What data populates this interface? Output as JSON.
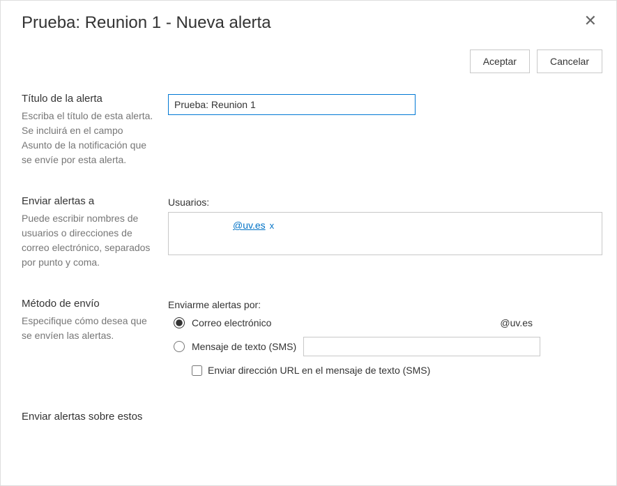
{
  "dialog": {
    "title": "Prueba: Reunion 1 - Nueva alerta",
    "close": "✕"
  },
  "buttons": {
    "accept": "Aceptar",
    "cancel": "Cancelar"
  },
  "sections": {
    "alertTitle": {
      "heading": "Título de la alerta",
      "description": "Escriba el título de esta alerta. Se incluirá en el campo Asunto de la notificación que se envíe por esta alerta.",
      "value": "Prueba: Reunion 1"
    },
    "sendTo": {
      "heading": "Enviar alertas a",
      "description": "Puede escribir nombres de usuarios o direcciones de correo electrónico, separados por punto y coma.",
      "usersLabel": "Usuarios:",
      "user": "@uv.es",
      "removeGlyph": "x"
    },
    "deliveryMethod": {
      "heading": "Método de envío",
      "description": "Especifique cómo desea que se envíen las alertas.",
      "groupLabel": "Enviarme alertas por:",
      "emailOption": "Correo electrónico",
      "emailValue": "@uv.es",
      "smsOption": "Mensaje de texto (SMS)",
      "smsValue": "",
      "urlCheckbox": "Enviar dirección URL en el mensaje de texto (SMS)"
    },
    "alertOn": {
      "heading": "Enviar alertas sobre estos"
    }
  }
}
